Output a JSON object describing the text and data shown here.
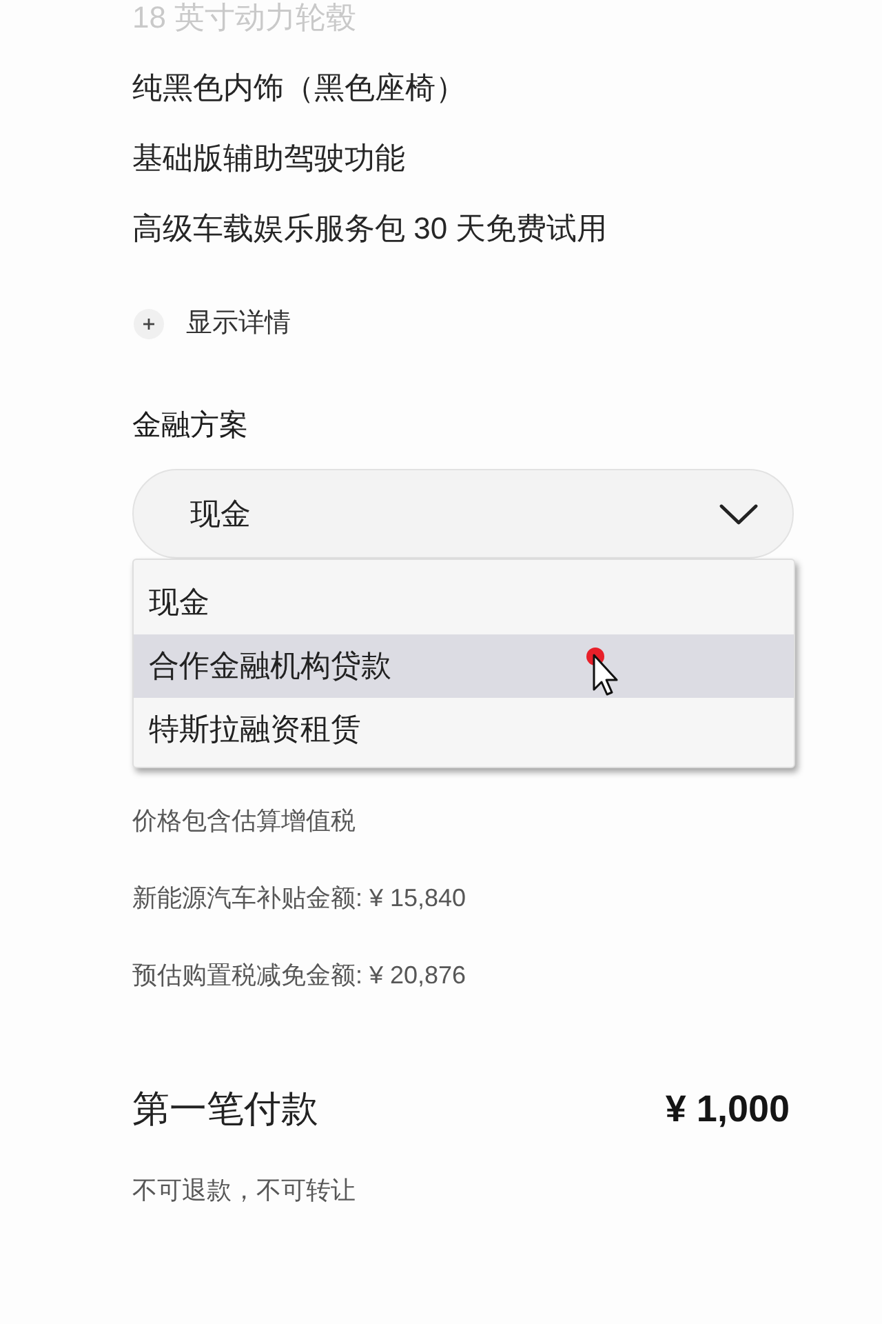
{
  "features": [
    {
      "text": "18 英寸动力轮毂",
      "faded": true
    },
    {
      "text": "纯黑色内饰（黑色座椅）",
      "faded": false
    },
    {
      "text": "基础版辅助驾驶功能",
      "faded": false
    },
    {
      "text": "高级车载娱乐服务包 30 天免费试用",
      "faded": false
    }
  ],
  "details_toggle": {
    "label": "显示详情",
    "expanded": false
  },
  "financing": {
    "label": "金融方案",
    "select": {
      "value": "现金",
      "expanded": true
    },
    "options": [
      {
        "label": "现金",
        "hovered": false
      },
      {
        "label": "合作金融机构贷款",
        "hovered": true
      },
      {
        "label": "特斯拉融资租赁",
        "hovered": false
      }
    ]
  },
  "notes": [
    "价格包含估算增值税",
    "新能源汽车补贴金额: ¥ 15,840",
    "预估购置税减免金额: ¥ 20,876"
  ],
  "first_payment": {
    "label": "第一笔付款",
    "amount": "¥ 1,000",
    "note": "不可退款，不可转让"
  }
}
